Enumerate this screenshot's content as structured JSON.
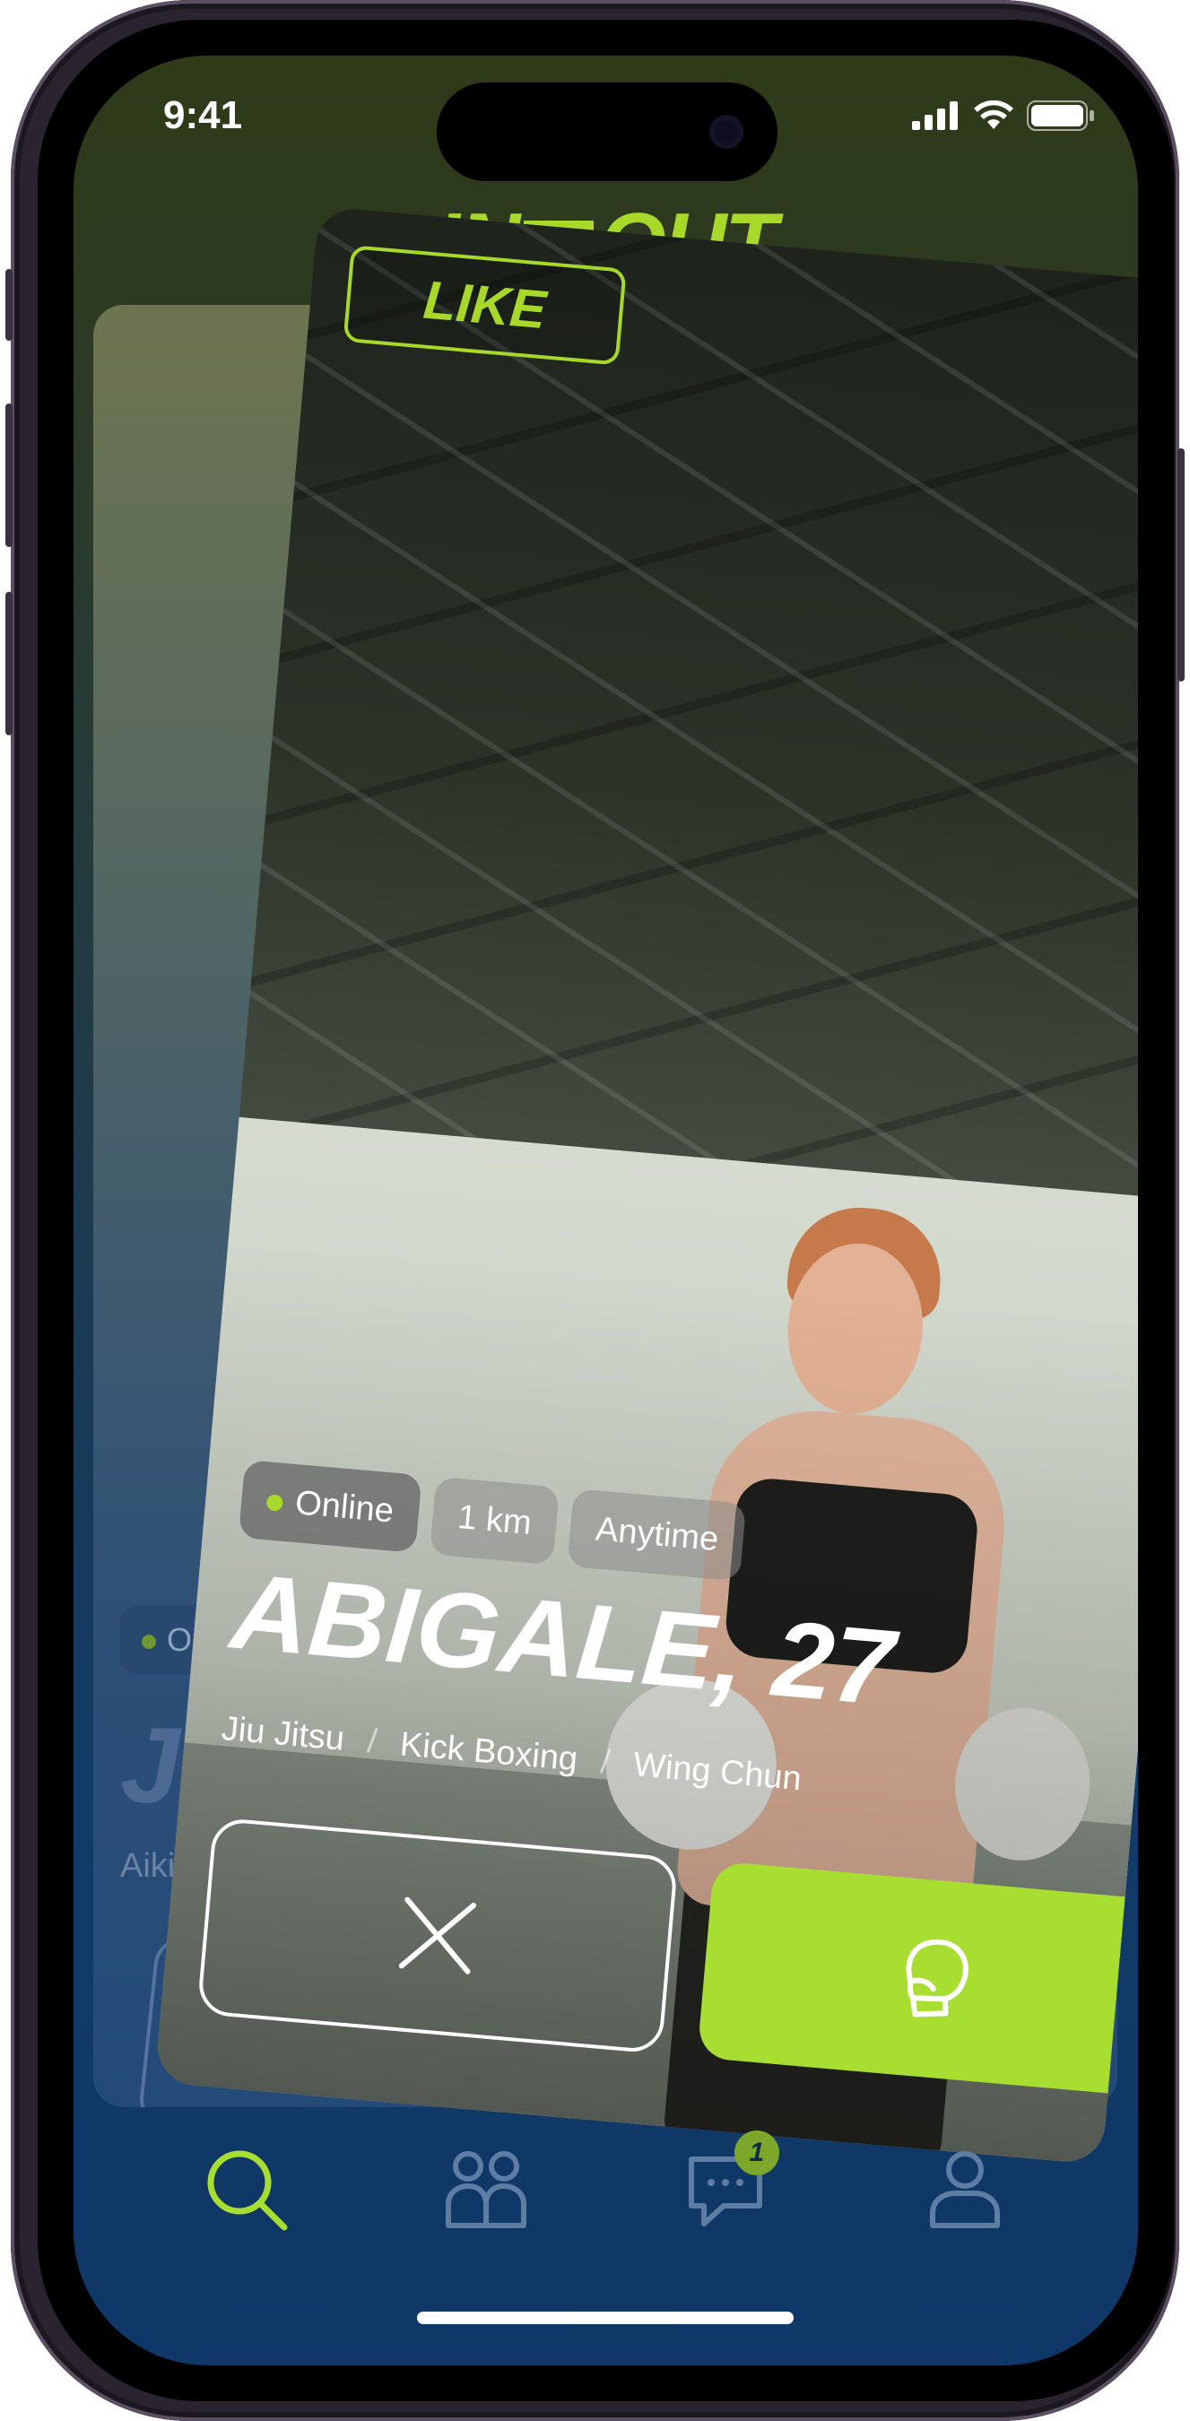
{
  "status_bar": {
    "time": "9:41"
  },
  "app": {
    "logo_left": "IN",
    "logo_right": "OUT"
  },
  "background_card": {
    "status": "Online",
    "name": "JES",
    "tag": "Aikido"
  },
  "card": {
    "stamp": "LIKE",
    "chips": {
      "online": "Online",
      "distance": "1 km",
      "availability": "Anytime"
    },
    "name": "ABIGALE, 27",
    "styles": [
      "Jiu Jitsu",
      "Kick Boxing",
      "Wing Chun"
    ],
    "separator": "/"
  },
  "tabbar": {
    "items": [
      {
        "icon": "search-icon",
        "active": true
      },
      {
        "icon": "people-icon",
        "active": false
      },
      {
        "icon": "chat-icon",
        "active": false,
        "badge": "1"
      },
      {
        "icon": "profile-icon",
        "active": false
      }
    ]
  },
  "colors": {
    "accent": "#a8de32",
    "tab_inactive": "#5e7da3",
    "background": "#123b66"
  }
}
